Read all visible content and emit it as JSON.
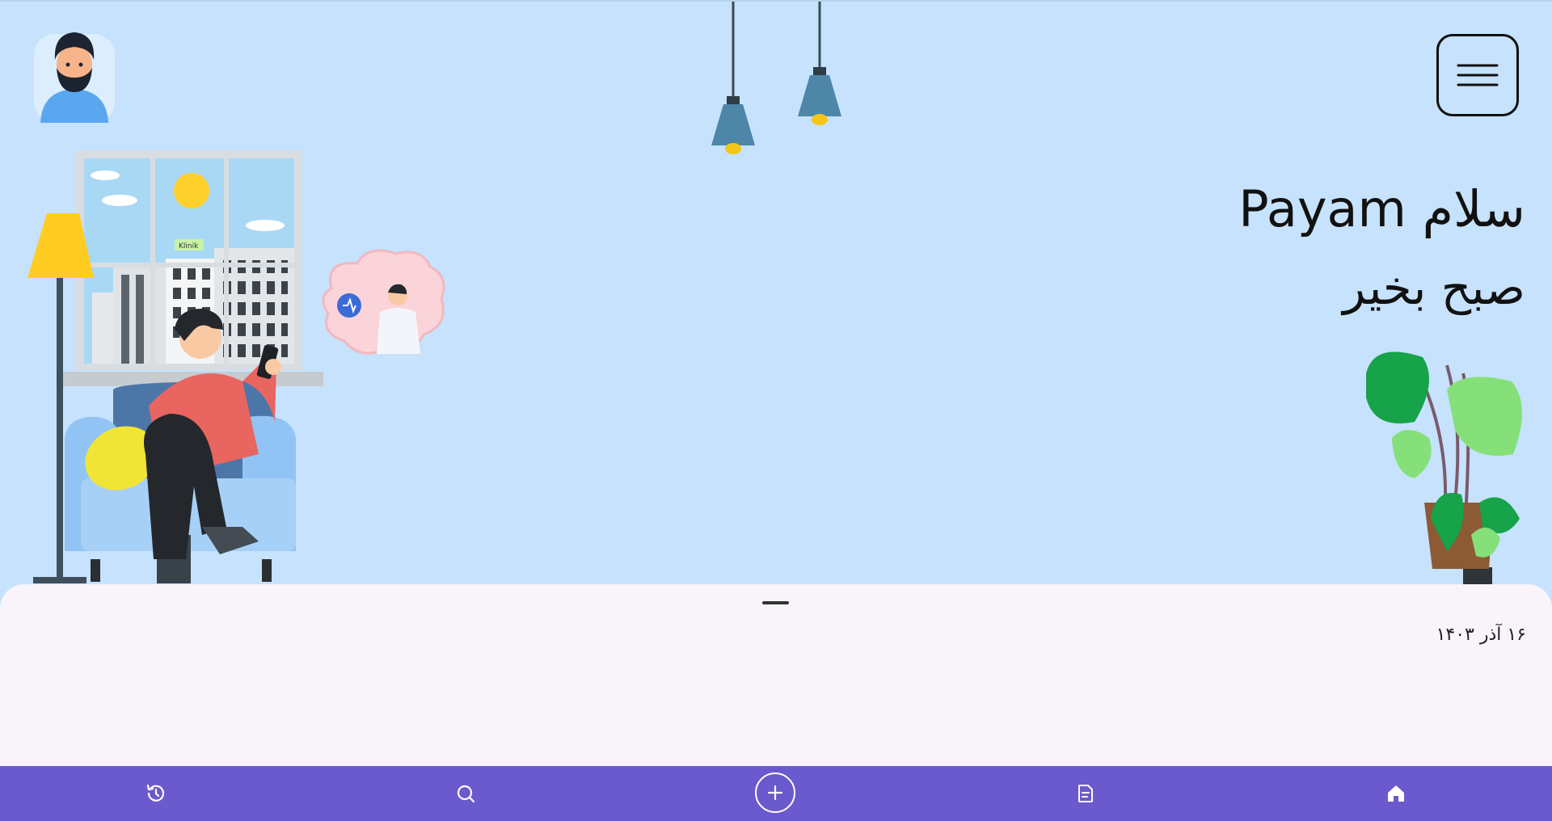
{
  "greeting": {
    "hello": "سلام Payam",
    "good_morning": "صبح بخیر"
  },
  "window_sign": "Klinik",
  "sheet": {
    "date": "۱۶ آذر ۱۴۰۳"
  },
  "icons": {
    "avatar": "user-avatar",
    "menu": "hamburger-menu-icon",
    "history": "history-icon",
    "search": "search-icon",
    "add": "plus-icon",
    "notes": "document-icon",
    "home": "home-icon"
  },
  "colors": {
    "hero_bg": "#c6e2fd",
    "nav_bg": "#6a5acd",
    "sheet_bg": "#f8f4fa"
  }
}
